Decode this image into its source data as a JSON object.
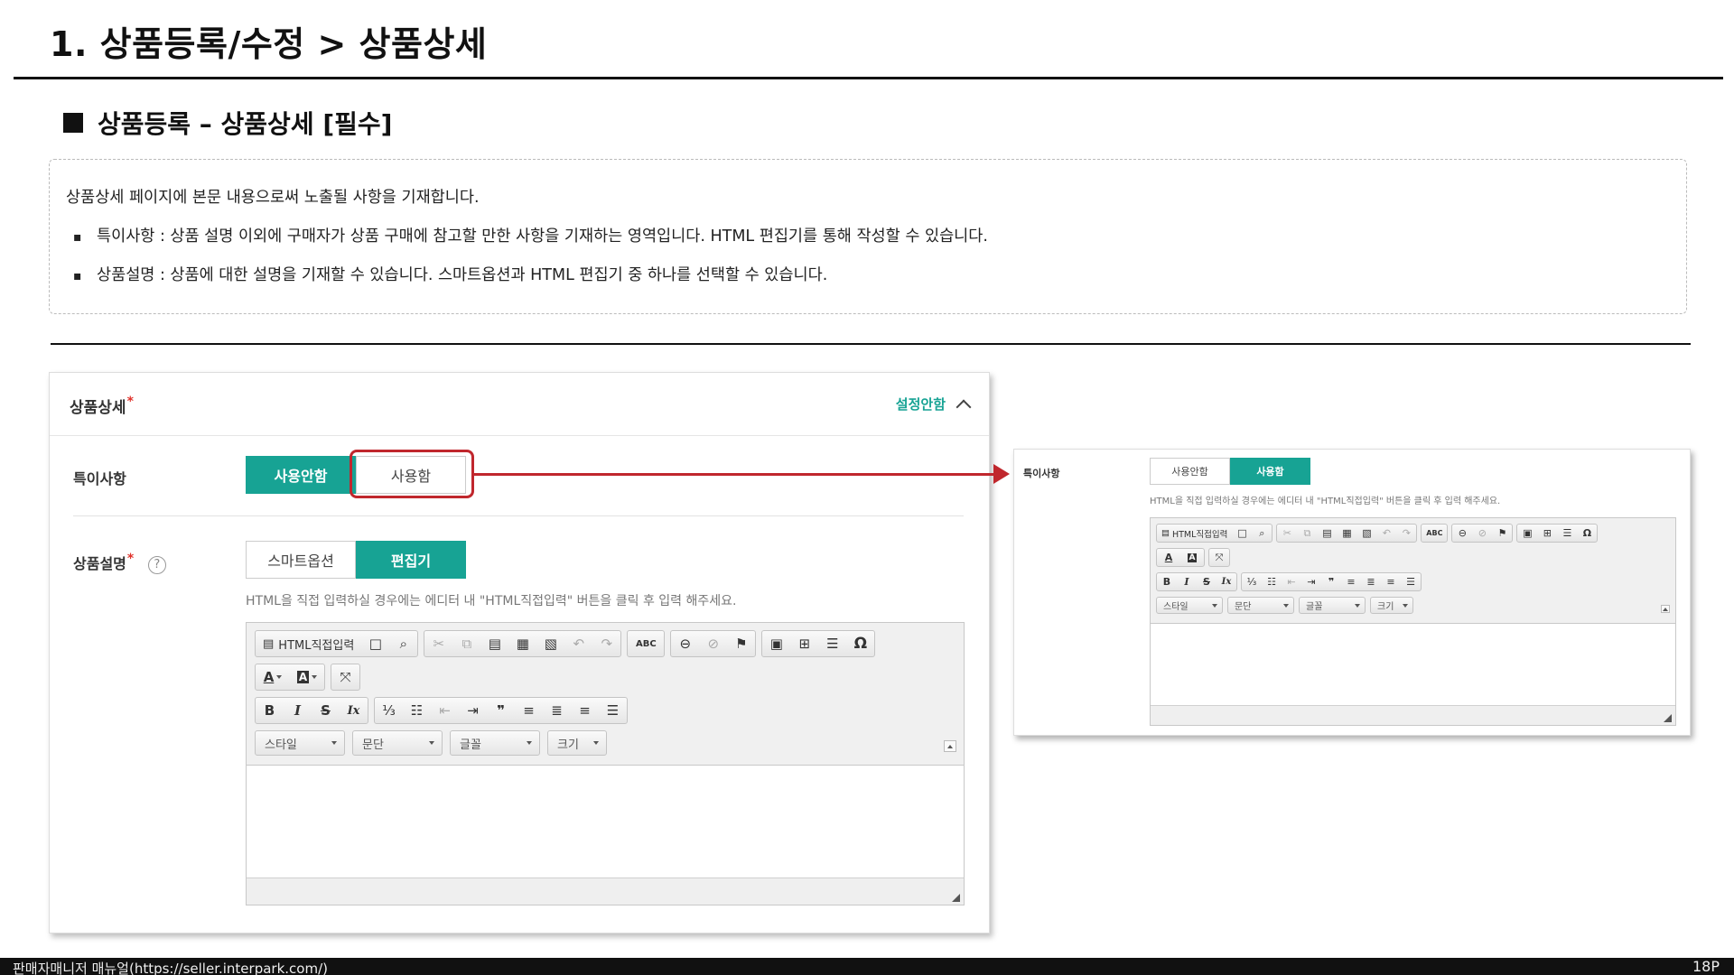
{
  "page_title": "1. 상품등록/수정 > 상품상세",
  "section_title": "상품등록 – 상품상세 [필수]",
  "description": {
    "intro": "상품상세 페이지에 본문 내용으로써 노출될 사항을 기재합니다.",
    "bullets": [
      "특이사항 : 상품 설명 이외에 구매자가 상품 구매에 참고할 만한 사항을 기재하는 영역입니다. HTML 편집기를 통해 작성할 수 있습니다.",
      "상품설명 : 상품에 대한 설명을 기재할 수 있습니다. 스마트옵션과 HTML 편집기 중 하나를 선택할 수 있습니다."
    ]
  },
  "panel": {
    "title": "상품상세",
    "required_mark": "*",
    "collapse_label": "설정안함",
    "special_notes": {
      "label": "특이사항",
      "options": [
        "사용안함",
        "사용함"
      ],
      "selected": "사용안함"
    },
    "description_field": {
      "label": "상품설명",
      "required_mark": "*",
      "help_glyph": "?",
      "options": [
        "스마트옵션",
        "편집기"
      ],
      "selected": "편집기",
      "hint": "HTML을 직접 입력하실 경우에는 에디터 내 \"HTML직접입력\" 버튼을 클릭 후 입력 해주세요."
    }
  },
  "editor": {
    "html_button": "HTML직접입력",
    "format_selects": [
      "스타일",
      "문단",
      "글꼴",
      "크기"
    ],
    "icons": {
      "new_page": "□",
      "preview": "⌕",
      "cut": "✂",
      "copy": "⧉",
      "paste": "▤",
      "paste_text": "▦",
      "paste_word": "▧",
      "undo": "↶",
      "redo": "↷",
      "spellcheck": "ABC",
      "link": "⊖",
      "unlink": "⊘",
      "anchor": "⚑",
      "image": "▣",
      "table": "⊞",
      "hr": "☰",
      "special_char": "Ω",
      "text_color": "A",
      "bg_color": "A",
      "maximize": "⤧",
      "bold": "B",
      "italic": "I",
      "strike": "S",
      "remove_format": "Ix",
      "numbered_list": "⅓",
      "bullet_list": "☷",
      "outdent": "⇤",
      "indent": "⇥",
      "blockquote": "❞",
      "align_left": "≡",
      "align_center": "≣",
      "align_right": "≡",
      "justify": "☰"
    }
  },
  "preview": {
    "label": "특이사항",
    "options": [
      "사용안함",
      "사용함"
    ],
    "selected": "사용함",
    "hint": "HTML을 직접 입력하실 경우에는 에디터 내 \"HTML직접입력\" 버튼을 클릭 후 입력 해주세요."
  },
  "footer": {
    "manual_text": "판매자매니저 매뉴얼(https://seller.interpark.com/)",
    "page_number": "18P"
  },
  "colors": {
    "accent": "#17a394",
    "highlight": "#c0272d",
    "required": "#e0322b"
  }
}
